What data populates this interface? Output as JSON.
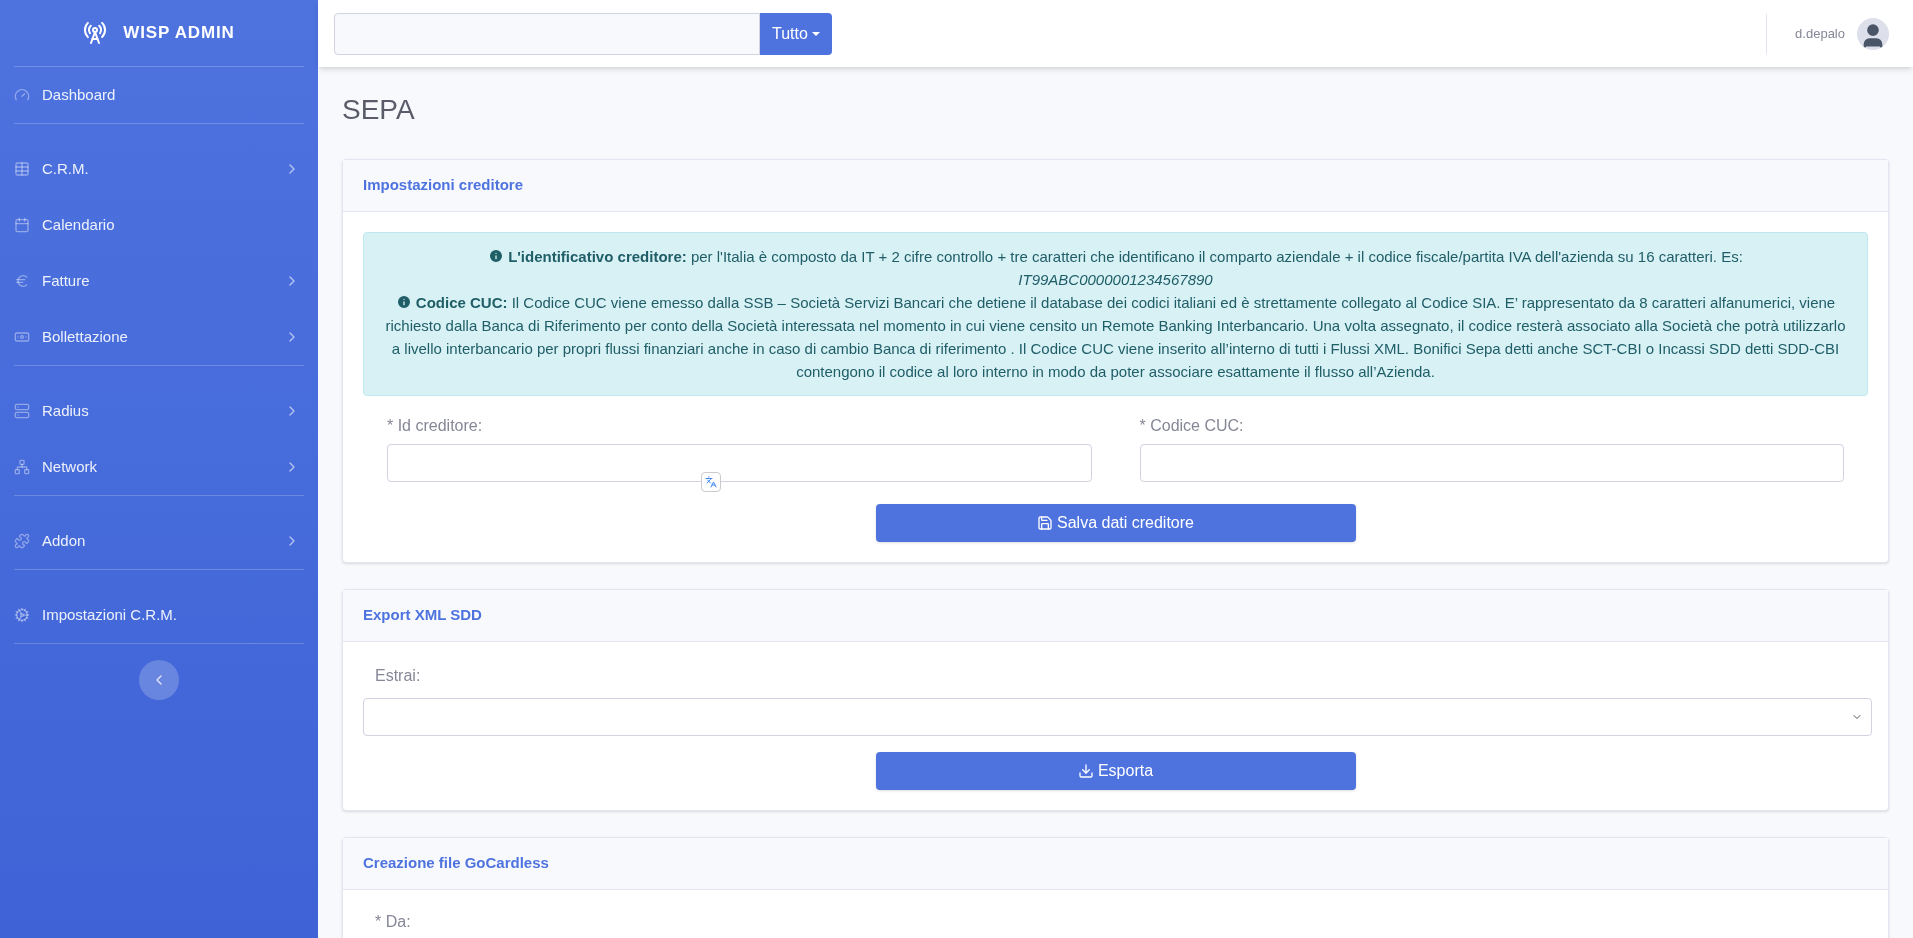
{
  "brand": "WISP ADMIN",
  "sidebar": {
    "groups": [
      [
        {
          "label": "Dashboard",
          "submenu": false
        }
      ],
      [
        {
          "label": "C.R.M.",
          "submenu": true
        },
        {
          "label": "Calendario",
          "submenu": false
        },
        {
          "label": "Fatture",
          "submenu": true
        },
        {
          "label": "Bollettazione",
          "submenu": true
        }
      ],
      [
        {
          "label": "Radius",
          "submenu": true
        },
        {
          "label": "Network",
          "submenu": true
        }
      ],
      [
        {
          "label": "Addon",
          "submenu": true
        }
      ],
      [
        {
          "label": "Impostazioni C.R.M.",
          "submenu": false
        }
      ]
    ]
  },
  "topbar": {
    "search_scope": "Tutto",
    "user": "d.depalo"
  },
  "page_title": "SEPA",
  "creditor_card": {
    "title": "Impostazioni creditore",
    "info": [
      {
        "text": "**L'identificativo creditore:** per l'Italia è composto da IT + 2 cifre controllo + tre caratteri che identificano il comparto aziendale + il codice fiscale/partita IVA dell'azienda su 16 caratteri. Es:",
        "example": "IT99ABC0000001234567890"
      },
      {
        "text": "**Codice CUC:** Il Codice CUC viene emesso dalla SSB – Società Servizi Bancari che detiene il database dei codici italiani ed è strettamente collegato al Codice SIA. E’ rappresentato da 8 caratteri alfanumerici, viene richiesto dalla Banca di Riferimento per conto della Società interessata nel momento in cui viene censito un Remote Banking Interbancario. Una volta assegnato, il codice resterà associato alla Società che potrà utilizzarlo a livello interbancario per propri flussi finanziari anche in caso di cambio Banca di riferimento . Il Codice CUC viene inserito all’interno di tutti i Flussi XML. Bonifici Sepa detti anche SCT-CBI o Incassi SDD detti SDD-CBI contengono il codice al loro interno in modo da poter associare esattamente il flusso all’Azienda."
      }
    ],
    "fields": [
      {
        "label": "* Id creditore:"
      },
      {
        "label": "* Codice CUC:"
      }
    ],
    "button": "Salva dati creditore"
  },
  "export_card": {
    "title": "Export XML SDD",
    "select_label": "Estrai:",
    "button": "Esporta"
  },
  "gocardless_card": {
    "title": "Creazione file GoCardless",
    "field_label": "* Da:"
  }
}
